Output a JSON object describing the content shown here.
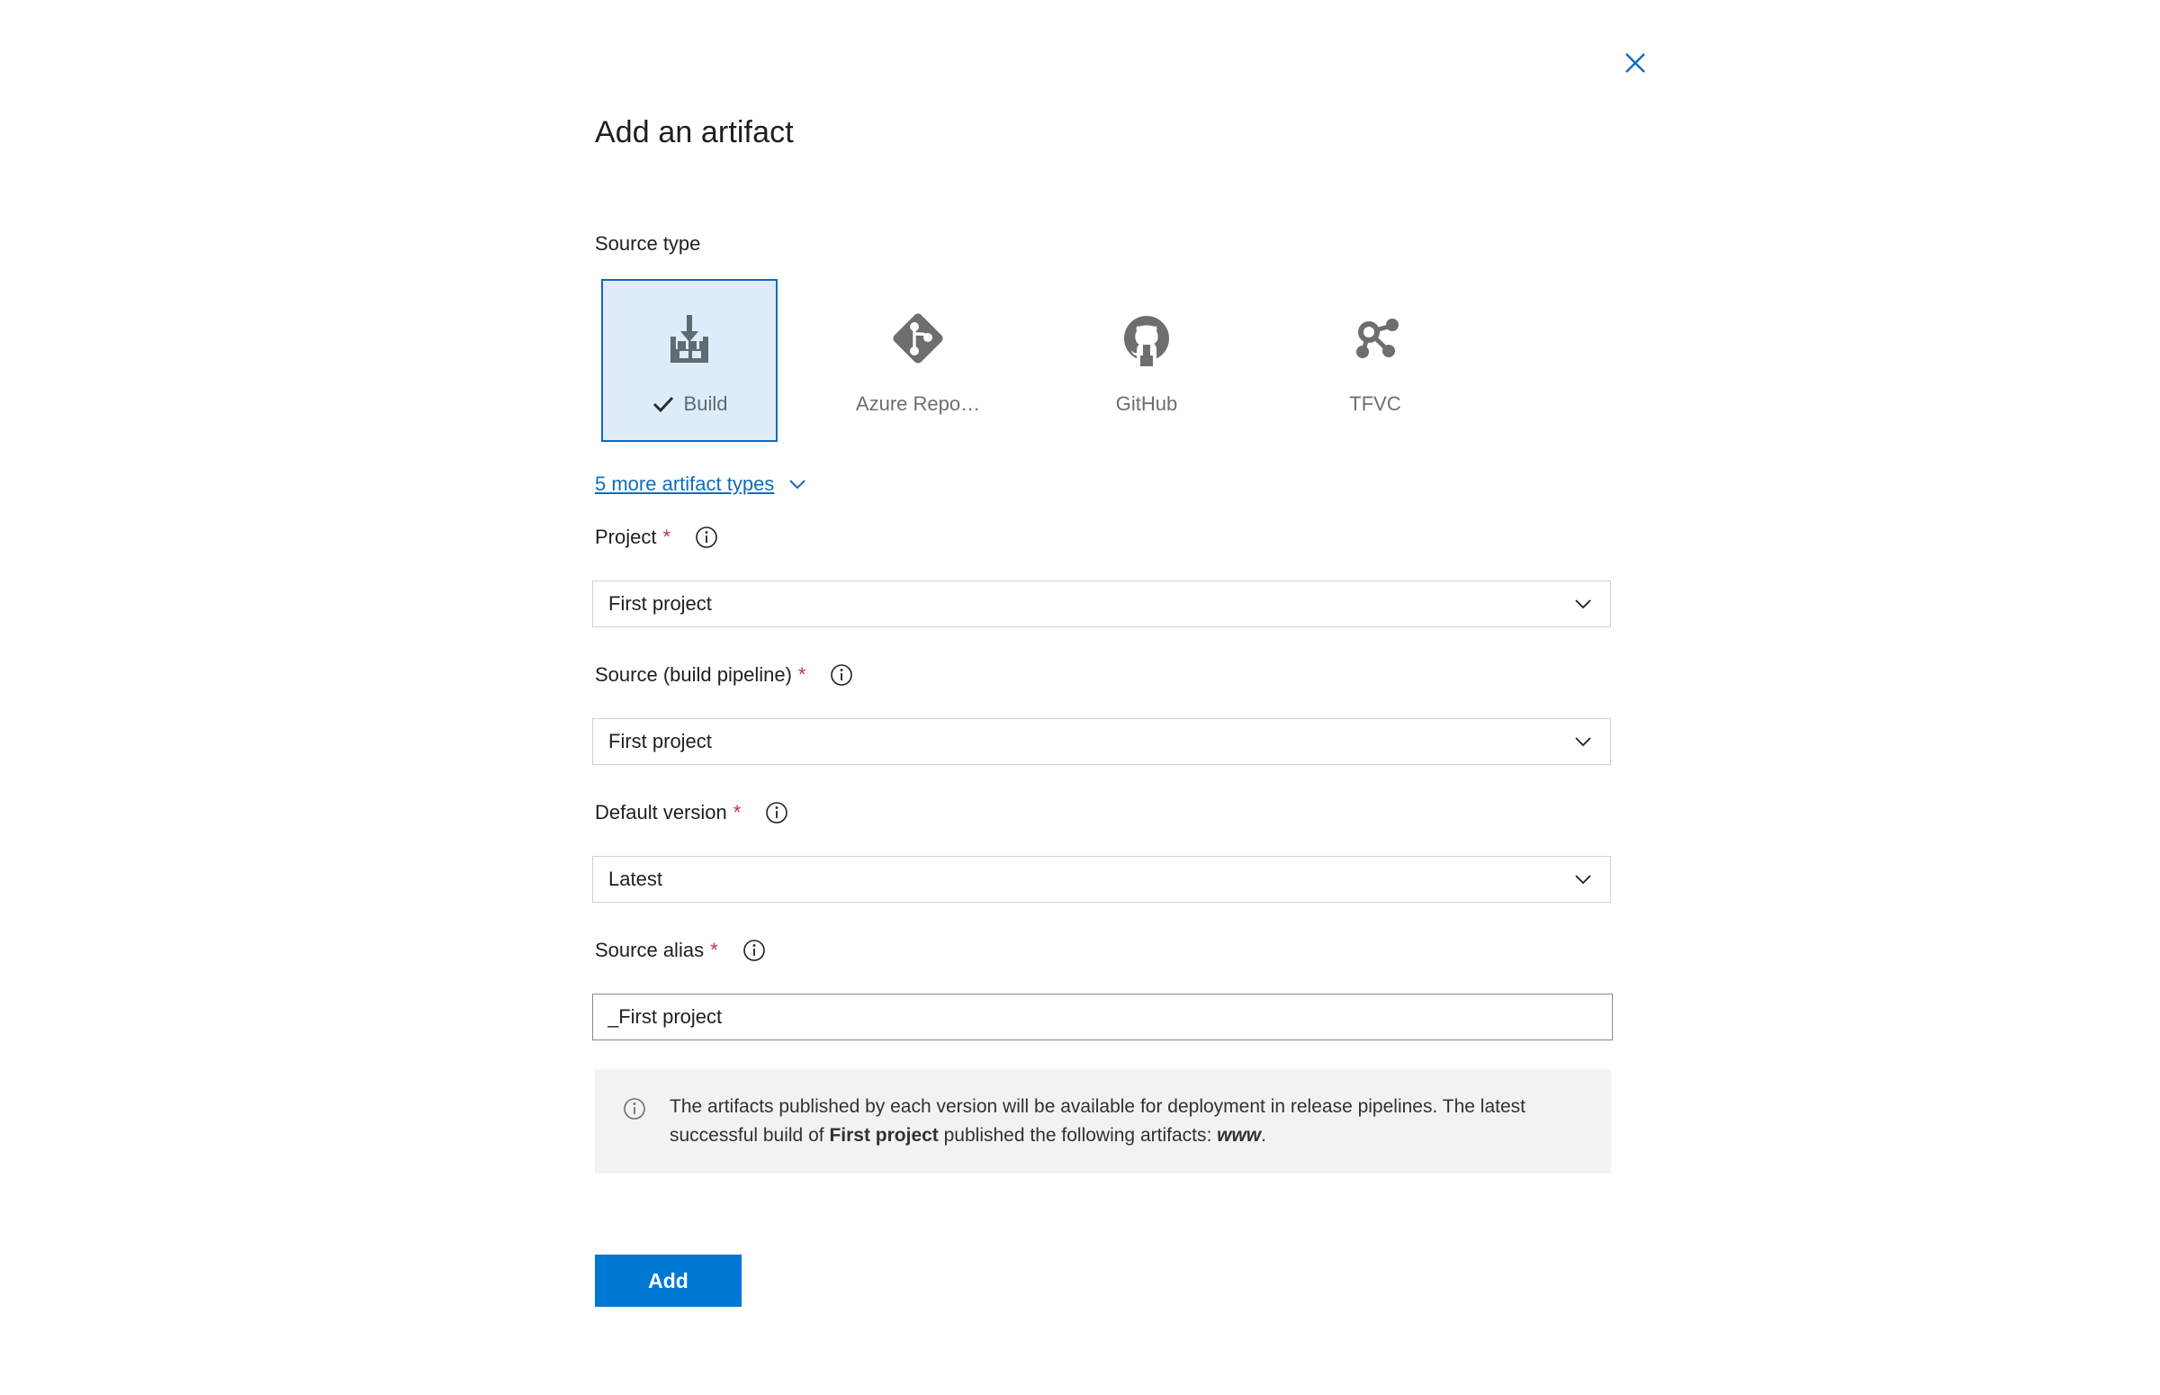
{
  "panel": {
    "title": "Add an artifact",
    "close_label": "Close"
  },
  "source_type": {
    "label": "Source type",
    "tiles": [
      {
        "label": "Build",
        "icon": "build-icon",
        "selected": true
      },
      {
        "label": "Azure Repo…",
        "icon": "azure-repos-icon",
        "selected": false
      },
      {
        "label": "GitHub",
        "icon": "github-icon",
        "selected": false
      },
      {
        "label": "TFVC",
        "icon": "tfvc-icon",
        "selected": false
      }
    ],
    "more_link": "5 more artifact types"
  },
  "fields": {
    "project": {
      "label": "Project",
      "required_marker": "*",
      "value": "First project"
    },
    "source": {
      "label": "Source (build pipeline)",
      "required_marker": "*",
      "value": "First project"
    },
    "default_version": {
      "label": "Default version",
      "required_marker": "*",
      "value": "Latest"
    },
    "source_alias": {
      "label": "Source alias",
      "required_marker": "*",
      "value": "_First project"
    }
  },
  "info_message": {
    "part1": "The artifacts published by each version will be available for deployment in release pipelines. The latest successful build of ",
    "bold": "First project",
    "part2": " published the following artifacts: ",
    "italic": "www",
    "part3": "."
  },
  "actions": {
    "add_label": "Add"
  },
  "colors": {
    "accent": "#0078d4",
    "link": "#0f6cbd",
    "selected_tile_border": "#0f6cbd",
    "selected_tile_fill": "#deecf9",
    "required_star": "#c4314b",
    "info_box_bg": "#f3f2f1",
    "icon_gray": "#6e6e6e"
  }
}
